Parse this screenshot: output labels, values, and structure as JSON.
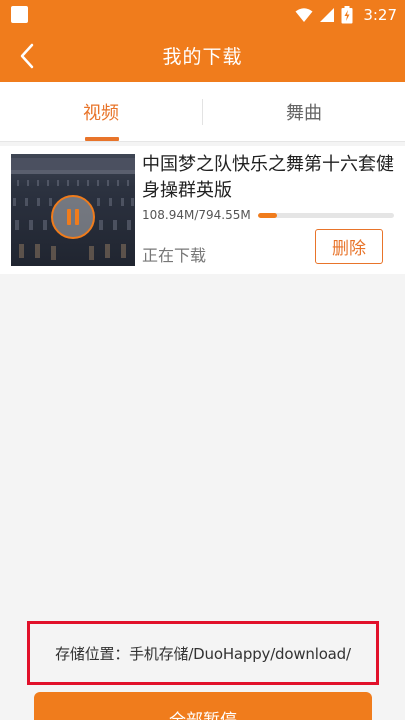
{
  "status_bar": {
    "time": "3:27"
  },
  "header": {
    "title": "我的下载"
  },
  "tabs": [
    {
      "label": "视频"
    },
    {
      "label": "舞曲"
    }
  ],
  "downloads": [
    {
      "title": "中国梦之队快乐之舞第十六套健身操群英版",
      "size": "108.94M/794.55M",
      "progress": 0.137,
      "status": "正在下载",
      "delete_label": "删除"
    }
  ],
  "storage": {
    "text": "存储位置：手机存储/DuoHappy/download/"
  },
  "footer": {
    "pause_all_label": "全部暂停"
  },
  "colors": {
    "accent": "#f07c1c",
    "highlight_border": "#e1102a"
  }
}
